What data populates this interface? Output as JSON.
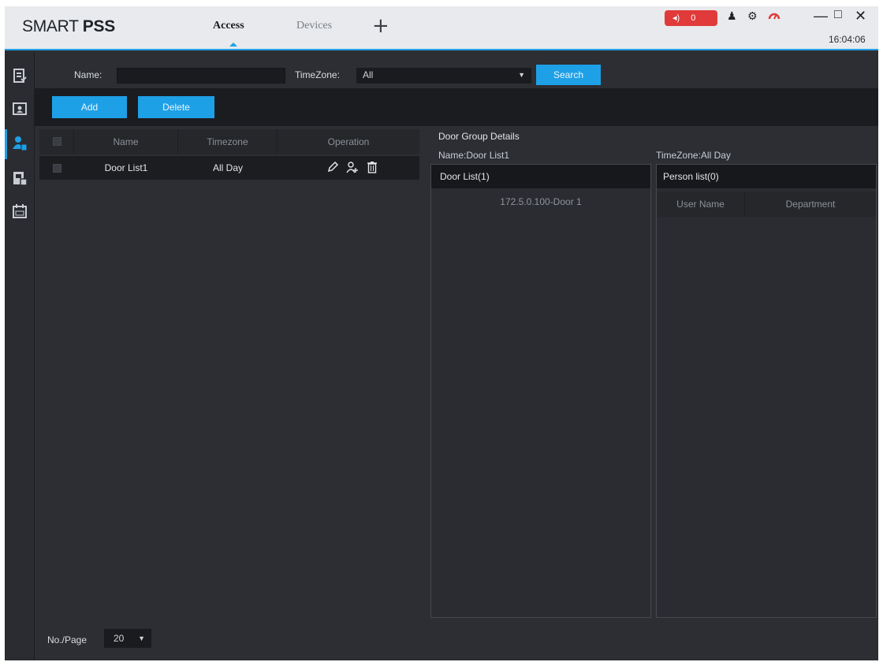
{
  "app": {
    "brand_light": "SMART",
    "brand_bold": "PSS",
    "tabs": [
      {
        "label": "Access",
        "active": true
      },
      {
        "label": "Devices",
        "active": false
      }
    ],
    "add_tab_glyph": "+",
    "alarm_count": "0",
    "clock": "16:04:06",
    "accent_color": "#1ea0e6",
    "alarm_color": "#e03a3a"
  },
  "rail": {
    "items": [
      {
        "icon": "access-record-icon"
      },
      {
        "icon": "person-card-icon"
      },
      {
        "icon": "door-group-icon",
        "active": true
      },
      {
        "icon": "door-config-icon"
      },
      {
        "icon": "calendar-icon"
      }
    ]
  },
  "search": {
    "name_label": "Name:",
    "name_value": "",
    "timezone_label": "TimeZone:",
    "timezone_value": "All",
    "search_label": "Search"
  },
  "toolbar": {
    "add_label": "Add",
    "delete_label": "Delete"
  },
  "group_table": {
    "columns": [
      "Name",
      "Timezone",
      "Operation"
    ],
    "rows": [
      {
        "name": "Door List1",
        "timezone": "All Day",
        "operations": [
          "edit-icon",
          "add-person-icon",
          "delete-icon"
        ]
      }
    ]
  },
  "details": {
    "title": "Door Group Details",
    "name_text": "Name:Door  List1",
    "timezone_text": "TimeZone:All Day",
    "door_list_title": "Door  List(1)",
    "door_items": [
      "172.5.0.100-Door 1"
    ],
    "person_list_title": "Person list(0)",
    "person_columns": [
      "User Name",
      "Department"
    ]
  },
  "footer": {
    "per_page_label": "No./Page",
    "per_page_value": "20"
  }
}
